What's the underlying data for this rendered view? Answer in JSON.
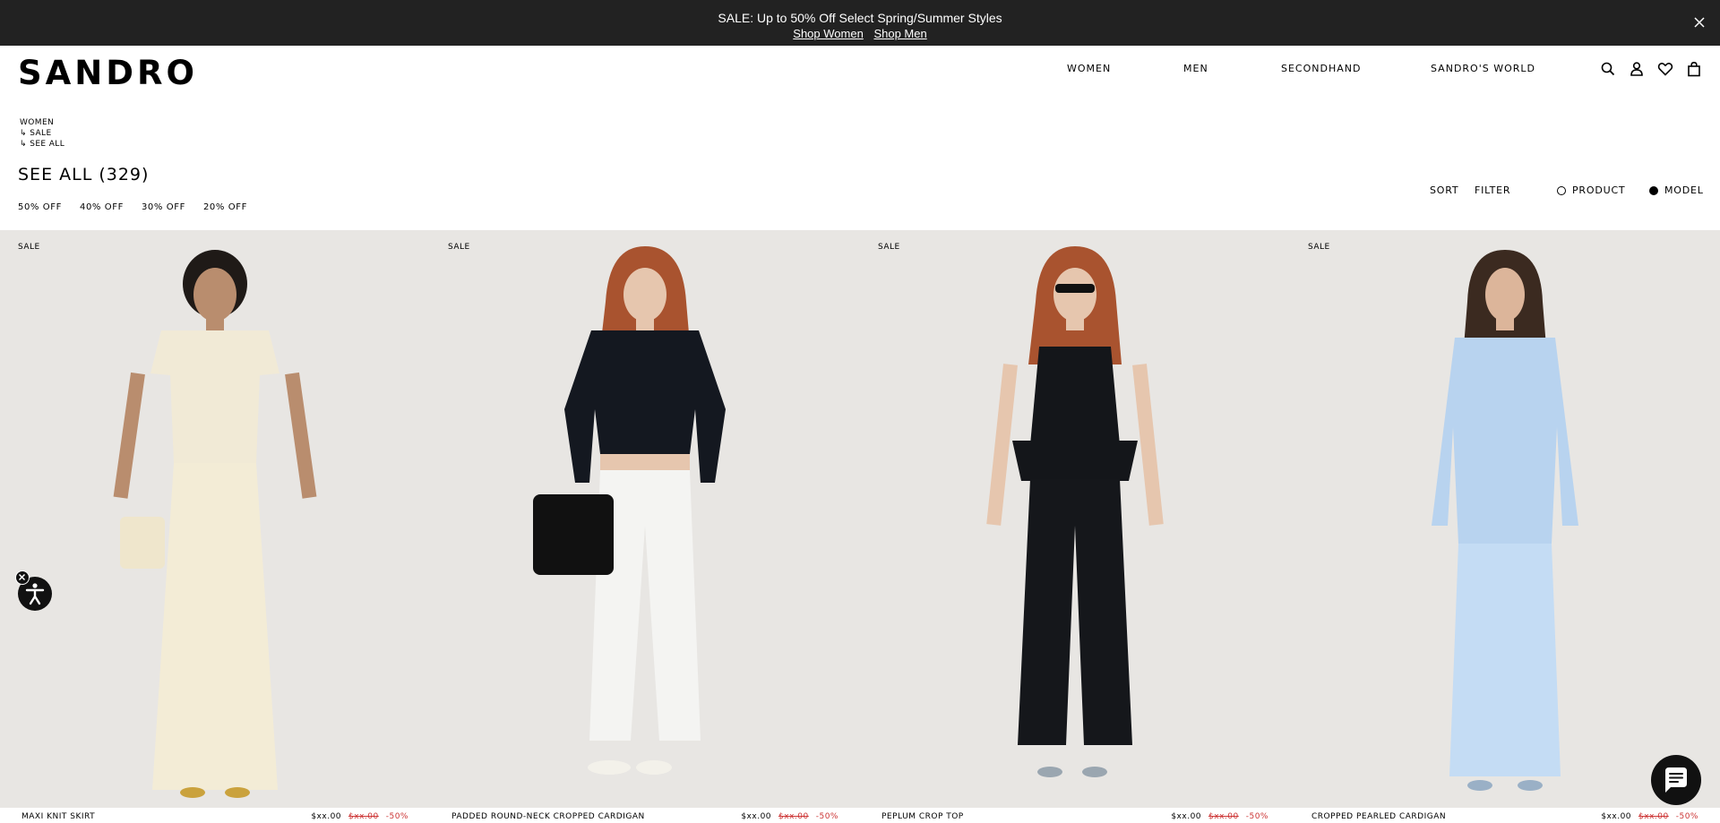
{
  "promo": {
    "text": "SALE: Up to 50% Off Select Spring/Summer Styles",
    "link_women": "Shop Women",
    "link_men": "Shop Men"
  },
  "header": {
    "logo": "SANDRO",
    "nav": [
      "WOMEN",
      "MEN",
      "SECONDHAND",
      "SANDRO'S WORLD"
    ],
    "icons": [
      "search-icon",
      "account-icon",
      "wishlist-icon",
      "bag-icon"
    ]
  },
  "breadcrumb": [
    "WOMEN",
    "↳ SALE",
    "↳ SEE ALL"
  ],
  "page": {
    "title": "SEE ALL",
    "count": "(329)",
    "discounts": [
      "50% OFF",
      "40% OFF",
      "30% OFF",
      "20% OFF"
    ],
    "sort_label": "SORT",
    "filter_label": "FILTER",
    "view_product_label": "PRODUCT",
    "view_model_label": "MODEL",
    "selected_view": "MODEL"
  },
  "products": [
    {
      "tag": "SALE",
      "name": "MAXI KNIT SKIRT",
      "price": "$xx.00",
      "old_price": "$xx.00",
      "discount": "-50%",
      "bg": "#e8e6e3",
      "top": "#f1ead6",
      "bottom": "#f3ecd6",
      "hair": "#1f1a17"
    },
    {
      "tag": "SALE",
      "name": "PADDED ROUND-NECK CROPPED CARDIGAN",
      "price": "$xx.00",
      "old_price": "$xx.00",
      "discount": "-50%",
      "bg": "#e8e6e3",
      "top": "#141820",
      "bottom": "#f4f4f2",
      "hair": "#a9532f"
    },
    {
      "tag": "SALE",
      "name": "PEPLUM CROP TOP",
      "price": "$xx.00",
      "old_price": "$xx.00",
      "discount": "-50%",
      "bg": "#e8e6e3",
      "top": "#14161a",
      "bottom": "#15171b",
      "hair": "#a9532f"
    },
    {
      "tag": "SALE",
      "name": "CROPPED PEARLED CARDIGAN",
      "price": "$xx.00",
      "old_price": "$xx.00",
      "discount": "-50%",
      "bg": "#e8e6e3",
      "top": "#b8d3ef",
      "bottom": "#c4dcf4",
      "hair": "#3b2a20"
    }
  ]
}
